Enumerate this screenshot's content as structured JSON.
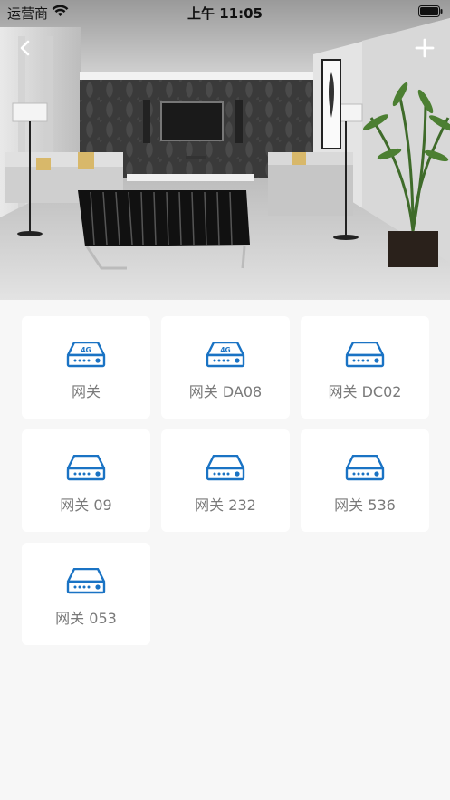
{
  "status_bar": {
    "carrier": "运营商",
    "time": "上午 11:05"
  },
  "nav": {
    "back_icon": "chevron-left-icon",
    "add_icon": "plus-icon"
  },
  "colors": {
    "accent": "#1a73c4",
    "card_bg": "#ffffff",
    "page_bg": "#f7f7f7",
    "label": "#7a7a7a"
  },
  "devices": [
    {
      "label": "网关",
      "icon": "gateway-4g-icon",
      "badge": "4G"
    },
    {
      "label": "网关 DA08",
      "icon": "gateway-4g-icon",
      "badge": "4G"
    },
    {
      "label": "网关 DC02",
      "icon": "gateway-icon"
    },
    {
      "label": "网关 09",
      "icon": "gateway-icon"
    },
    {
      "label": "网关 232",
      "icon": "gateway-icon"
    },
    {
      "label": "网关 536",
      "icon": "gateway-icon"
    },
    {
      "label": "网关 053",
      "icon": "gateway-icon"
    }
  ]
}
